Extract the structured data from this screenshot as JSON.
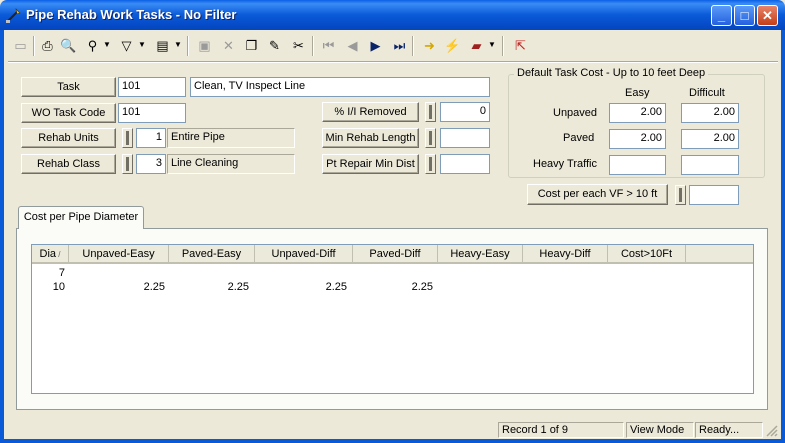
{
  "window": {
    "title": "Pipe Rehab Work Tasks - No Filter",
    "minimize": "_",
    "maximize": "□",
    "close": "✕"
  },
  "toolbar": {
    "icons": [
      "new-icon",
      "print-icon",
      "print-preview-icon",
      "find-icon",
      "filter-icon",
      "report-icon",
      "save-icon",
      "delete-icon",
      "copy-icon",
      "edit-icon",
      "cut-icon",
      "first-record-icon",
      "previous-record-icon",
      "next-record-icon",
      "last-record-icon",
      "goto-icon",
      "action-icon",
      "books-icon",
      "exit-icon"
    ]
  },
  "form": {
    "task_button": "Task",
    "task_code": "101",
    "task_desc": "Clean, TV Inspect Line",
    "wo_task_code_button": "WO Task Code",
    "wo_task_code": "101",
    "rehab_units_button": "Rehab Units",
    "rehab_units_value": "1",
    "rehab_units_text": "Entire Pipe",
    "rehab_class_button": "Rehab Class",
    "rehab_class_value": "3",
    "rehab_class_text": "Line Cleaning",
    "ii_removed_button": "% I/I Removed",
    "ii_removed_value": "0",
    "min_rehab_length_button": "Min Rehab Length",
    "min_rehab_length_value": "",
    "pt_repair_button": "Pt Repair Min Dist",
    "pt_repair_value": "",
    "cost_vf_button": "Cost per each VF > 10 ft",
    "cost_vf_value": ""
  },
  "default_cost": {
    "title": "Default Task Cost  -  Up to 10 feet Deep",
    "col_easy": "Easy",
    "col_difficult": "Difficult",
    "row_unpaved": "Unpaved",
    "row_paved": "Paved",
    "row_heavy": "Heavy Traffic",
    "unpaved_easy": "2.00",
    "unpaved_difficult": "2.00",
    "paved_easy": "2.00",
    "paved_difficult": "2.00",
    "heavy_easy": "",
    "heavy_difficult": ""
  },
  "tab": {
    "label": "Cost per Pipe Diameter"
  },
  "grid": {
    "columns": [
      "Dia",
      "Unpaved-Easy",
      "Paved-Easy",
      "Unpaved-Diff",
      "Paved-Diff",
      "Heavy-Easy",
      "Heavy-Diff",
      "Cost>10Ft"
    ],
    "rows": [
      [
        "7",
        "",
        "",
        "",
        "",
        "",
        "",
        ""
      ],
      [
        "10",
        "2.25",
        "2.25",
        "2.25",
        "2.25",
        "",
        "",
        ""
      ]
    ]
  },
  "status": {
    "record": "Record 1 of 9",
    "mode": "View Mode",
    "state": "Ready..."
  }
}
